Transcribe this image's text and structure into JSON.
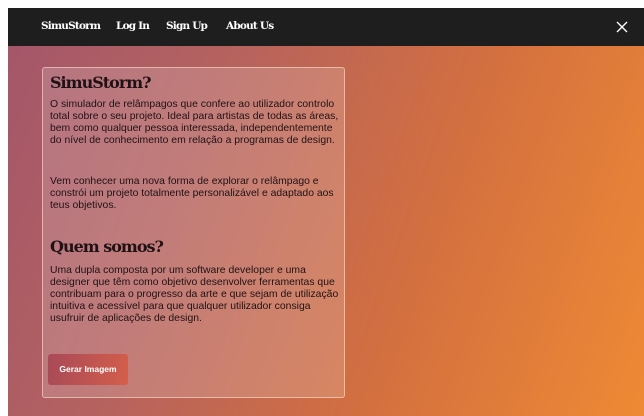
{
  "nav": {
    "items": [
      {
        "label": "SimuStorm"
      },
      {
        "label": "Log In"
      },
      {
        "label": "Sign Up"
      },
      {
        "label": "About Us"
      }
    ]
  },
  "icons": {
    "close": "close-icon"
  },
  "content": {
    "section1": {
      "title": "SimuStorm?",
      "paragraph1": "O simulador de relâmpagos que  confere ao utilizador controlo total  sobre o seu projeto. Ideal para artistas de todas as áreas, bem como qualquer pessoa interessada, independentemente do nível de conhecimento em  relação a programas de design.",
      "paragraph2": "Vem conhecer uma nova forma de explorar o relâmpago e constrói um projeto totalmente personalizável  e adaptado aos teus objetivos."
    },
    "section2": {
      "title": "Quem somos?",
      "paragraph1": "Uma dupla composta por um software developer e uma designer que têm como objetivo desenvolver ferramentas que contribuam para o progresso da arte e que sejam de utilização intuitiva e acessível para que qualquer utilizador consiga usufruir de aplicações de design."
    },
    "button_label": "Gerar Imagem"
  },
  "colors": {
    "navbar": "#1e1e1e",
    "gradient_start": "#a3566a",
    "gradient_end": "#ee8a34",
    "text": "#1f1215"
  }
}
